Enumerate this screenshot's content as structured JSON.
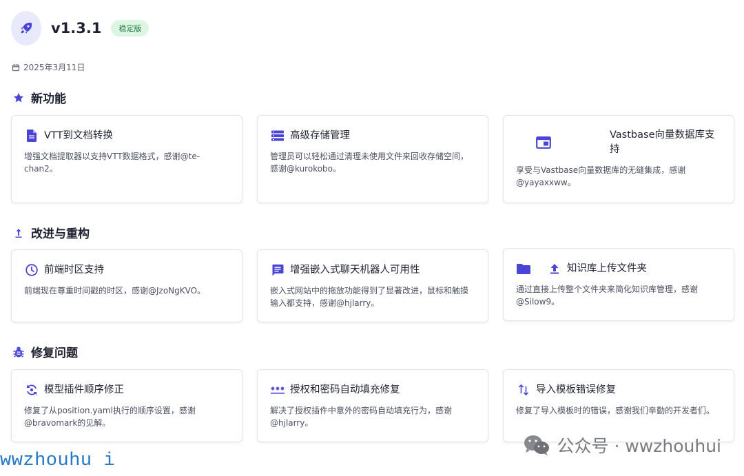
{
  "header": {
    "logo_icon": "rocket-icon",
    "version": "v1.3.1",
    "badge": "稳定版"
  },
  "release_date": "2025年3月11日",
  "colors": {
    "accent": "#4b45d6",
    "badge_bg": "#dcf6e3",
    "badge_text": "#1f7a3e"
  },
  "sections": [
    {
      "title": "新功能",
      "icon": "star-icon",
      "cards": [
        {
          "icon": "document-icon",
          "title": "VTT到文档转换",
          "desc": "增强文档提取器以支持VTT数据格式，感谢@te-chan2。"
        },
        {
          "icon": "storage-list-icon",
          "title": "高级存储管理",
          "desc": "管理员可以轻松通过清理未使用文件来回收存储空间，感谢@kurokobo。"
        },
        {
          "icon": "window-icon",
          "title": "Vastbase向量数据库支持",
          "desc": "享受与Vastbase向量数据库的无缝集成，感谢@yayaxxww。"
        }
      ]
    },
    {
      "title": "改进与重构",
      "icon": "arrow-up-icon",
      "cards": [
        {
          "icon": "clock-icon",
          "title": "前端时区支持",
          "desc": "前端现在尊重时间戳的时区，感谢@JzoNgKVO。"
        },
        {
          "icon": "chat-icon",
          "title": "增强嵌入式聊天机器人可用性",
          "desc": "嵌入式网站中的拖放功能得到了显著改进，鼠标和触摸输入都支持，感谢@hjlarry。"
        },
        {
          "icon": "folder-upload-icon",
          "title": "知识库上传文件夹",
          "desc": "通过直接上传整个文件夹来简化知识库管理，感谢@Silow9。"
        }
      ]
    },
    {
      "title": "修复问题",
      "icon": "bug-icon",
      "cards": [
        {
          "icon": "reorder-icon",
          "title": "模型插件顺序修正",
          "desc": "修复了从position.yaml执行的顺序设置，感谢@bravomark的见解。"
        },
        {
          "icon": "password-icon",
          "title": "授权和密码自动填充修复",
          "desc": "解决了授权插件中意外的密码自动填充行为，感谢@hjlarry。"
        },
        {
          "icon": "swap-arrows-icon",
          "title": "导入模板错误修复",
          "desc": "修复了导入模板时的错误，感谢我们辛勤的开发者们。"
        }
      ]
    }
  ],
  "watermark": {
    "icon": "wechat-icon",
    "text": "公众号 · wwzhouhui"
  },
  "corner_text": "wwzhouhu i"
}
